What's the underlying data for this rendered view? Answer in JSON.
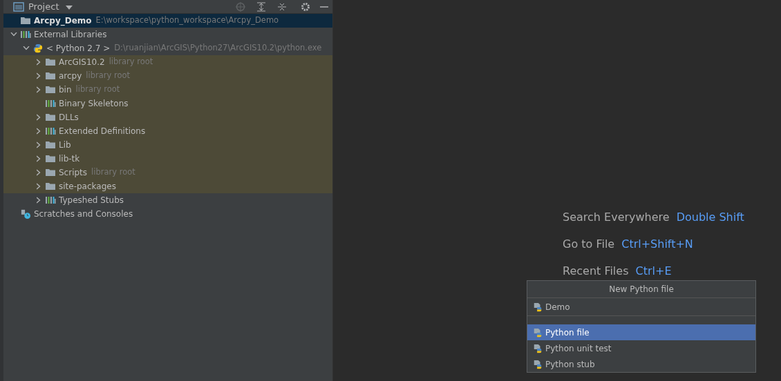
{
  "project_panel": {
    "title": "Project",
    "tree": [
      {
        "label": "Arcpy_Demo",
        "hint": "E:\\workspace\\python_workspace\\Arcpy_Demo",
        "kind": "project",
        "selected": true,
        "highlighted": false,
        "expandable": false
      },
      {
        "label": "External Libraries",
        "kind": "library",
        "selected": false,
        "highlighted": false,
        "expandable": true,
        "expanded": true,
        "children": [
          {
            "label": "< Python 2.7 >",
            "hint": "D:\\ruanjian\\ArcGIS\\Python27\\ArcGIS10.2\\python.exe",
            "kind": "python",
            "selected": false,
            "highlighted": false,
            "expandable": true,
            "expanded": true,
            "children": [
              {
                "label": "ArcGIS10.2",
                "hint": "library root",
                "kind": "folder",
                "selected": false,
                "highlighted": true,
                "expandable": true,
                "expanded": false
              },
              {
                "label": "arcpy",
                "hint": "library root",
                "kind": "folder",
                "selected": false,
                "highlighted": true,
                "expandable": true,
                "expanded": false
              },
              {
                "label": "bin",
                "hint": "library root",
                "kind": "folder",
                "selected": false,
                "highlighted": true,
                "expandable": true,
                "expanded": false
              },
              {
                "label": "Binary Skeletons",
                "kind": "library",
                "selected": false,
                "highlighted": true,
                "expandable": false
              },
              {
                "label": "DLLs",
                "kind": "folder",
                "selected": false,
                "highlighted": true,
                "expandable": true,
                "expanded": false
              },
              {
                "label": "Extended Definitions",
                "kind": "library",
                "selected": false,
                "highlighted": true,
                "expandable": true,
                "expanded": false
              },
              {
                "label": "Lib",
                "kind": "folder",
                "selected": false,
                "highlighted": true,
                "expandable": true,
                "expanded": false
              },
              {
                "label": "lib-tk",
                "kind": "folder",
                "selected": false,
                "highlighted": true,
                "expandable": true,
                "expanded": false
              },
              {
                "label": "Scripts",
                "hint": "library root",
                "kind": "folder",
                "selected": false,
                "highlighted": true,
                "expandable": true,
                "expanded": false
              },
              {
                "label": "site-packages",
                "kind": "folder",
                "selected": false,
                "highlighted": true,
                "expandable": true,
                "expanded": false
              },
              {
                "label": "Typeshed Stubs",
                "kind": "library",
                "selected": false,
                "highlighted": false,
                "expandable": true,
                "expanded": false
              }
            ]
          }
        ]
      },
      {
        "label": "Scratches and Consoles",
        "kind": "scratches",
        "selected": false,
        "highlighted": false,
        "expandable": false
      }
    ]
  },
  "editor_hints": [
    {
      "action": "Search Everywhere",
      "shortcut": "Double Shift"
    },
    {
      "action": "Go to File",
      "shortcut": "Ctrl+Shift+N"
    },
    {
      "action": "Recent Files",
      "shortcut": "Ctrl+E"
    }
  ],
  "new_file_popup": {
    "title": "New Python file",
    "value": "Demo",
    "options": [
      {
        "label": "Python file",
        "selected": true
      },
      {
        "label": "Python unit test",
        "selected": false
      },
      {
        "label": "Python stub",
        "selected": false
      }
    ]
  }
}
